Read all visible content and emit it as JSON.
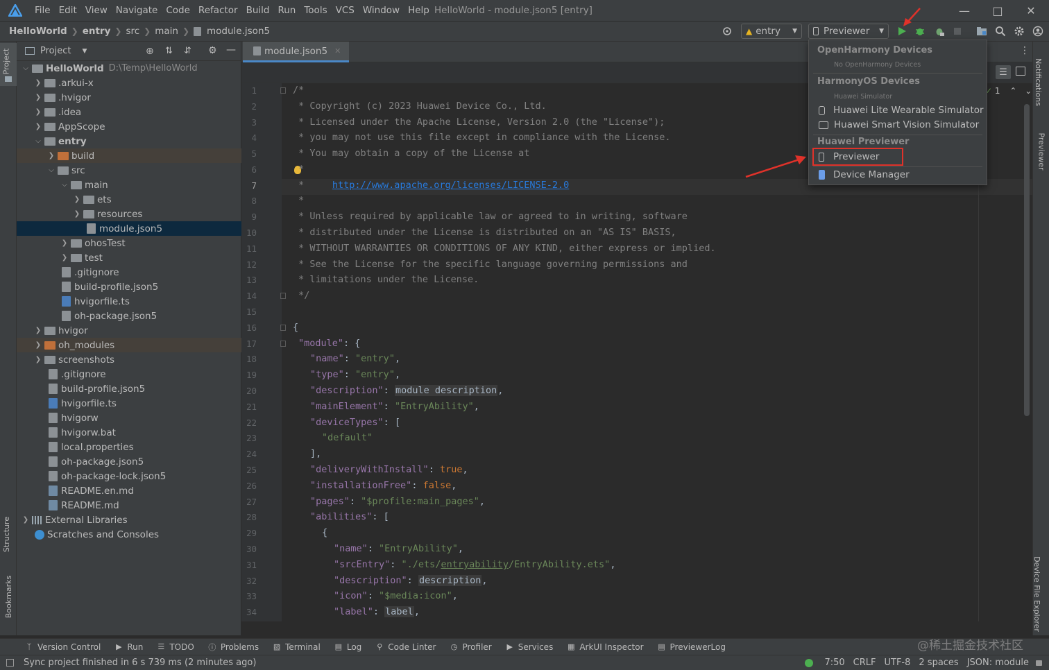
{
  "window": {
    "title": "HelloWorld - module.json5 [entry]",
    "menu": [
      "File",
      "Edit",
      "View",
      "Navigate",
      "Code",
      "Refactor",
      "Build",
      "Run",
      "Tools",
      "VCS",
      "Window",
      "Help"
    ]
  },
  "breadcrumb": [
    "HelloWorld",
    "entry",
    "src",
    "main",
    "module.json5"
  ],
  "toolbar": {
    "module_combo": "entry",
    "device_combo": "Previewer"
  },
  "project_panel": {
    "title": "Project",
    "tree": [
      {
        "label": "HelloWorld",
        "path": "D:\\Temp\\HelloWorld"
      },
      {
        "label": ".arkui-x"
      },
      {
        "label": ".hvigor"
      },
      {
        "label": ".idea"
      },
      {
        "label": "AppScope"
      },
      {
        "label": "entry"
      },
      {
        "label": "build"
      },
      {
        "label": "src"
      },
      {
        "label": "main"
      },
      {
        "label": "ets"
      },
      {
        "label": "resources"
      },
      {
        "label": "module.json5"
      },
      {
        "label": "ohosTest"
      },
      {
        "label": "test"
      },
      {
        "label": ".gitignore"
      },
      {
        "label": "build-profile.json5"
      },
      {
        "label": "hvigorfile.ts"
      },
      {
        "label": "oh-package.json5"
      },
      {
        "label": "hvigor"
      },
      {
        "label": "oh_modules"
      },
      {
        "label": "screenshots"
      },
      {
        "label": ".gitignore"
      },
      {
        "label": "build-profile.json5"
      },
      {
        "label": "hvigorfile.ts"
      },
      {
        "label": "hvigorw"
      },
      {
        "label": "hvigorw.bat"
      },
      {
        "label": "local.properties"
      },
      {
        "label": "oh-package.json5"
      },
      {
        "label": "oh-package-lock.json5"
      },
      {
        "label": "README.en.md"
      },
      {
        "label": "README.md"
      },
      {
        "label": "External Libraries"
      },
      {
        "label": "Scratches and Consoles"
      }
    ]
  },
  "editor": {
    "tab": "module.json5",
    "line_numbers": [
      "1",
      "2",
      "3",
      "4",
      "5",
      "6",
      "7",
      "8",
      "9",
      "10",
      "11",
      "12",
      "13",
      "14",
      "15",
      "16",
      "17",
      "18",
      "19",
      "20",
      "21",
      "22",
      "23",
      "24",
      "25",
      "26",
      "27",
      "28",
      "29",
      "30",
      "31",
      "32",
      "33",
      "34"
    ],
    "inspection_count": "1",
    "code": {
      "l1": "/*",
      "l2": " * Copyright (c) 2023 Huawei Device Co., Ltd.",
      "l3": " * Licensed under the Apache License, Version 2.0 (the \"License\");",
      "l4": " * you may not use this file except in compliance with the License.",
      "l5": " * You may obtain a copy of the License at",
      "l6": " *",
      "l7a": " *     ",
      "l7b": "http://www.apache.org/licenses/LICENSE-2.0",
      "l8": " *",
      "l9": " * Unless required by applicable law or agreed to in writing, software",
      "l10": " * distributed under the License is distributed on an \"AS IS\" BASIS,",
      "l11": " * WITHOUT WARRANTIES OR CONDITIONS OF ANY KIND, either express or implied.",
      "l12": " * See the License for the specific language governing permissions and",
      "l13": " * limitations under the License.",
      "l14": " */",
      "l16": "{",
      "k17": "\"module\"",
      "p17": ": {",
      "k18": "\"name\"",
      "v18": "\"entry\"",
      "k19": "\"type\"",
      "v19": "\"entry\"",
      "k20": "\"description\"",
      "v20": "module description",
      "k21": "\"mainElement\"",
      "v21": "\"EntryAbility\"",
      "k22": "\"deviceTypes\"",
      "p22": ": [",
      "v23": "\"default\"",
      "p24": "],",
      "k25": "\"deliveryWithInstall\"",
      "v25": "true",
      "k26": "\"installationFree\"",
      "v26": "false",
      "k27": "\"pages\"",
      "v27": "\"$profile:main_pages\"",
      "k28": "\"abilities\"",
      "p28": ": [",
      "p29": "{",
      "k30": "\"name\"",
      "v30": "\"EntryAbility\"",
      "k31": "\"srcEntry\"",
      "v31a": "\"./ets/",
      "v31b": "entryability",
      "v31c": "/EntryAbility.ets\"",
      "k32": "\"description\"",
      "v32": "description",
      "k33": "\"icon\"",
      "v33": "\"$media:icon\"",
      "k34": "\"label\"",
      "v34": "label"
    }
  },
  "device_dropdown": {
    "group1": "OpenHarmony Devices",
    "group1_sub": "No OpenHarmony Devices",
    "group2": "HarmonyOS Devices",
    "group2_sub": "Huawei Simulator",
    "item_wearable": "Huawei Lite Wearable Simulator",
    "item_vision": "Huawei Smart Vision Simulator",
    "group3": "Huawei Previewer",
    "item_previewer": "Previewer",
    "item_device_manager": "Device Manager"
  },
  "side_labels": {
    "project": "Project",
    "structure": "Structure",
    "bookmarks": "Bookmarks",
    "notifications": "Notifications",
    "previewer": "Previewer",
    "device_file_explorer": "Device File Explorer"
  },
  "bottom_tools": [
    "Version Control",
    "Run",
    "TODO",
    "Problems",
    "Terminal",
    "Log",
    "Code Linter",
    "Profiler",
    "Services",
    "ArkUI Inspector",
    "PreviewerLog"
  ],
  "status": {
    "message": "Sync project finished in 6 s 739 ms (2 minutes ago)",
    "position": "7:50",
    "line_sep": "CRLF",
    "encoding": "UTF-8",
    "indent": "2 spaces",
    "schema": "JSON: module"
  },
  "watermark": "@稀土掘金技术社区",
  "colors": {
    "accent": "#4a88c7",
    "highlight_box": "#e0322a",
    "run": "#4caf50",
    "selection": "#0d293e"
  }
}
